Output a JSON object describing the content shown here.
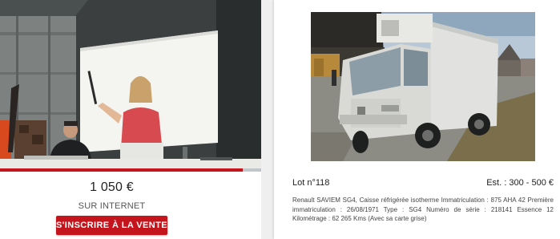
{
  "live": {
    "bid_amount": "1 050 €",
    "bid_channel": "SUR INTERNET",
    "register_label": "S'INSCRIRE À LA VENTE",
    "video_progress": 0.93,
    "accent_color": "#c4151c"
  },
  "lot": {
    "number_label": "Lot n°118",
    "estimate_label": "Est. : 300 - 500 €",
    "description": "Renault SAVIEM SG4, Caisse réfrigérée isotherme Immatriculation : 875 AHA 42 Première immatriculation : 26/08/1971 Type : SG4 Numéro de série : 218141 Essence 12 Kilométrage : 62 265 Kms (Avec sa carte grise)"
  }
}
